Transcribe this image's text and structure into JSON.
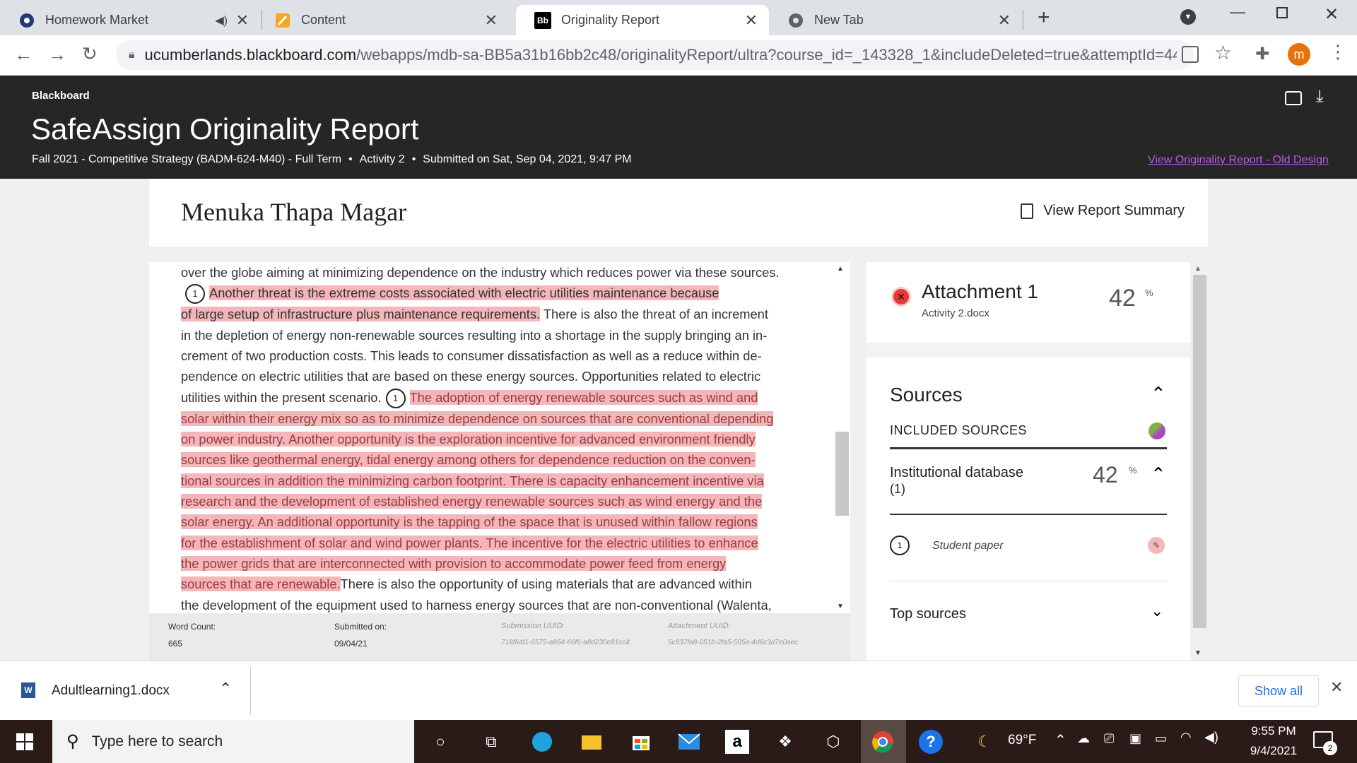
{
  "tabs": [
    {
      "title": "Homework Market",
      "icon": "homework-market-icon"
    },
    {
      "title": "Content",
      "icon": "content-icon"
    },
    {
      "title": "Originality Report",
      "icon": "blackboard-icon"
    },
    {
      "title": "New Tab",
      "icon": "chrome-icon"
    }
  ],
  "browser": {
    "url_domain": "ucumberlands.blackboard.com",
    "url_path": "/webapps/mdb-sa-BB5a31b16bb2c48/originalityReport/ultra?course_id=_143328_1&includeDeleted=true&attemptId=441...",
    "profile_initial": "m",
    "blackboard_fav": "Bb"
  },
  "header": {
    "brand": "Blackboard",
    "title": "SafeAssign Originality Report",
    "course": "Fall 2021 - Competitive Strategy (BADM-624-M40) - Full Term",
    "activity": "Activity 2",
    "submitted": "Submitted on Sat, Sep 04, 2021, 9:47 PM",
    "old_design_link": "View Originality Report - Old Design"
  },
  "student": {
    "name": "Menuka Thapa Magar",
    "summary_btn": "View Report Summary"
  },
  "document": {
    "p1": "over the globe aiming at minimizing dependence on the industry which reduces power via these sources.",
    "marker1": "1",
    "h1a": "Another threat is the extreme costs associated with electric utilities maintenance because",
    "h1b": "of large setup of infrastructure plus maintenance requirements.",
    "p2a": "There is also the threat of an increment",
    "p2b": "in the depletion of energy non-renewable sources resulting into a shortage in the supply bringing an in-",
    "p2c": "crement of two production costs. This leads to consumer dissatisfaction as well as a reduce within de-",
    "p2d": "pendence on electric utilities that are based on these energy sources. Opportunities related to electric",
    "p2e": "utilities within the present scenario.",
    "marker2": "1",
    "h2a": "The adoption of energy renewable sources such as wind and",
    "h2b": "solar within their energy mix so as to minimize dependence on sources that are conventional depending",
    "h2c": "on power industry. Another opportunity is the exploration incentive for advanced environment friendly",
    "h2d": "sources like geothermal energy, tidal energy among others for dependence reduction on the conven-",
    "h2e": "tional sources in addition the minimizing carbon footprint. There is capacity enhancement incentive via",
    "h2f": "research and the development of established energy renewable sources such as wind energy and the",
    "h2g": "solar energy. An additional opportunity is the tapping of the space that is unused within fallow regions",
    "h2h": "for the establishment of solar and wind power plants. The incentive for the electric utilities to enhance",
    "h2i": "the power grids that are interconnected with provision to accommodate power feed from energy",
    "h2j": "sources that are renewable.",
    "p3a": "There is also the opportunity of using materials that are advanced within",
    "p3b": "the development of the equipment used to harness energy sources that are non-conventional (Walenta,"
  },
  "footer": {
    "word_count_label": "Word Count:",
    "word_count": "665",
    "submitted_label": "Submitted on:",
    "submitted": "09/04/21",
    "submission_uuid_label": "Submission UUID:",
    "submission_uuid": "718f64f1-6575-a954-66f6-a8d230e81cc4",
    "attachment_uuid_label": "Attachment UUID:",
    "attachment_uuid": "5c837fa8-051b-2fa5-505a-4d6c3d7e0aec"
  },
  "panel": {
    "attachment_title": "Attachment 1",
    "attachment_file": "Activity 2.docx",
    "attachment_pct": "42",
    "pct_sign": "%",
    "sources_heading": "Sources",
    "included_sources": "INCLUDED SOURCES",
    "institutional_db": "Institutional database",
    "institutional_count": "(1)",
    "institutional_pct": "42",
    "source_num": "1",
    "source_name": "Student paper",
    "top_sources": "Top sources"
  },
  "download": {
    "file": "Adultlearning1.docx",
    "show_all": "Show all",
    "file_icon_letter": "W"
  },
  "taskbar": {
    "search_placeholder": "Type here to search",
    "weather": "69°F",
    "time": "9:55 PM",
    "date": "9/4/2021",
    "notif_count": "2",
    "amazon_letter": "a",
    "help_glyph": "?"
  },
  "colors": {
    "highlight": "#f4b6b8",
    "header_bg": "#262626",
    "link_purple": "#b75be0",
    "accent_orange": "#e8710a"
  }
}
